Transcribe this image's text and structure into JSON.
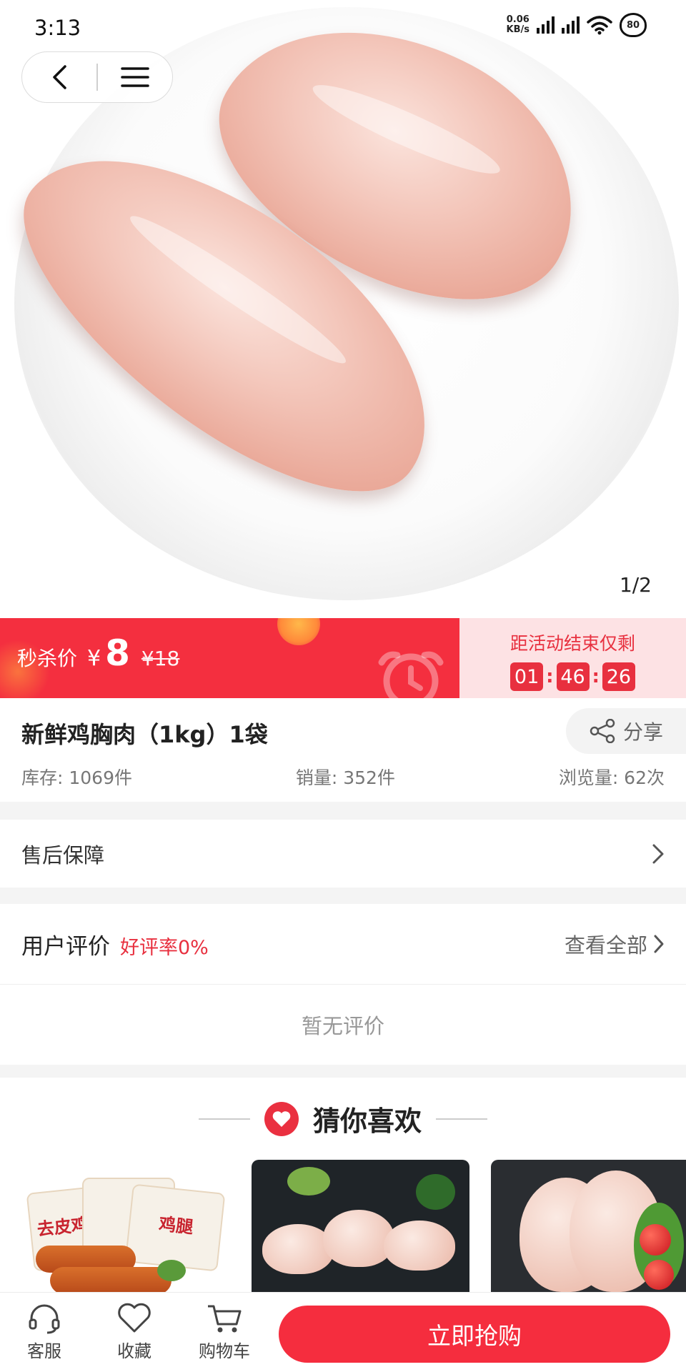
{
  "status_bar": {
    "time": "3:13",
    "net_speed_value": "0.06",
    "net_speed_unit": "KB/s",
    "battery": "80"
  },
  "hero": {
    "image_counter": "1/2"
  },
  "flash_sale": {
    "label": "秒杀价",
    "currency": "¥",
    "price": "8",
    "original_price": "¥18",
    "countdown_label": "距活动结束仅剩",
    "countdown": {
      "hours": "01",
      "minutes": "46",
      "seconds": "26"
    },
    "bg_color": "#f42f3f"
  },
  "product": {
    "title": "新鲜鸡胸肉（1kg）1袋",
    "share_label": "分享",
    "stock": "库存: 1069件",
    "sales": "销量: 352件",
    "views": "浏览量: 62次"
  },
  "after_sale": {
    "label": "售后保障"
  },
  "reviews": {
    "title": "用户评价",
    "rating": "好评率0%",
    "view_all": "查看全部",
    "empty_text": "暂无评价"
  },
  "recommendations": {
    "title": "猜你喜欢",
    "pack_text_left": "去皮鸡",
    "pack_text_right": "鸡腿"
  },
  "bottom_bar": {
    "tabs": [
      {
        "label": "客服",
        "icon": "headset-icon"
      },
      {
        "label": "收藏",
        "icon": "heart-outline-icon"
      },
      {
        "label": "购物车",
        "icon": "cart-icon"
      }
    ],
    "buy_label": "立即抢购",
    "accent": "#f52d3e"
  }
}
